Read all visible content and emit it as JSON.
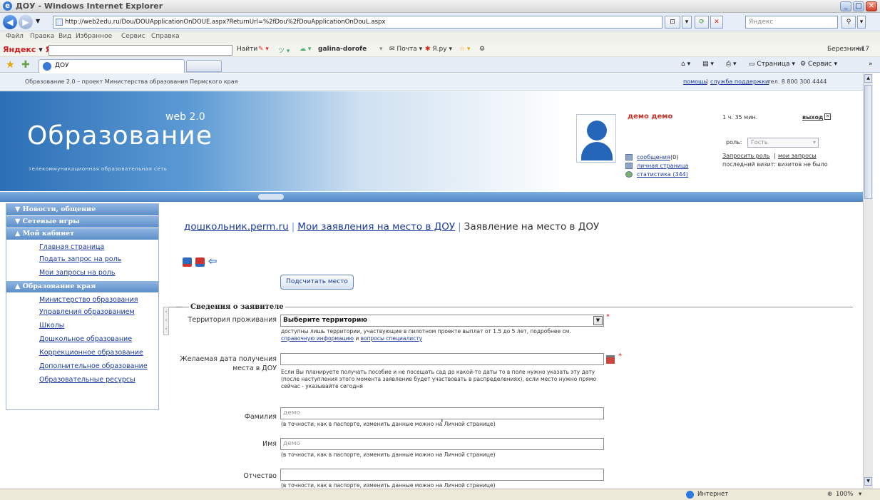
{
  "window": {
    "title": "ДОУ - Windows Internet Explorer",
    "url": "http://web2edu.ru/Dou/DOUApplicationOnDOUE.aspx?ReturnUrl=%2fDou%2fDouApplicationOnDouL.aspx",
    "search_placeholder": "Яндекс"
  },
  "menu": [
    "Файл",
    "Правка",
    "Вид",
    "Избранное",
    "Сервис",
    "Справка"
  ],
  "yandex_toolbar": {
    "logo_prefix": "Яндекс",
    "logo_ya": "Я",
    "find": "Найти",
    "user": "galina-dorofe",
    "mail": "Почта",
    "yaru": "Я.ру",
    "right_user": "Березники",
    "temp": "+17"
  },
  "tabs": {
    "active": "ДОУ",
    "commands": [
      "Страница",
      "Сервис"
    ]
  },
  "site": {
    "top_strip": "Образование 2.0 – проект Министерства образования Пермского края",
    "help": "помощь",
    "support": "служба поддержки",
    "phone": "тел. 8 800 300 4444",
    "logo": "Образование",
    "logo_web": "web 2.0",
    "logo_sub": "телекоммуникационная образовательная сеть"
  },
  "user": {
    "name": "демо демо",
    "links": [
      "сообщения",
      "личная страница",
      "статистика (344)"
    ],
    "messages_count": "(0)",
    "time": "1 ч. 35 мин.",
    "logout": "выход",
    "role_label": "роль:",
    "role_value": "Гость",
    "request_role": "Запросить роль",
    "my_requests": "мои запросы",
    "last_visit": "последний визит: визитов не было"
  },
  "sidebar": {
    "sections": [
      {
        "title": "Новости, общение",
        "expanded": false,
        "items": []
      },
      {
        "title": "Сетевые игры",
        "expanded": false,
        "items": []
      },
      {
        "title": "Мой кабинет",
        "expanded": true,
        "items": [
          "Главная страница",
          "Подать запрос на роль",
          "Мои запросы на роль"
        ]
      },
      {
        "title": "Образование края",
        "expanded": true,
        "items": [
          "Министерство образования",
          "Управления образованием",
          "Школы",
          "Дошкольное образование",
          "Коррекционное образование",
          "Дополнительное образование",
          "Образовательные ресурсы"
        ]
      }
    ]
  },
  "content": {
    "breadcrumb": [
      "дошкольник.perm.ru",
      "Мои заявления на место в ДОУ"
    ],
    "page_title": "Заявление на место в ДОУ",
    "count_button": "Подсчитать место",
    "section": "Сведения о заявителе",
    "fields": {
      "territory_label": "Территория проживания",
      "territory_value": "Выберите территорию",
      "territory_hint": "доступны лишь территории, участвующие в пилотном проекте выплат от 1.5 до 5 лет, подробнее см.",
      "territory_hint_link1": "справочную информацию",
      "territory_hint_and": "и",
      "territory_hint_link2": "вопросы специалисту",
      "date_label": "Желаемая дата получения места в ДОУ",
      "date_value": "",
      "date_hint": "Если Вы планируете получать пособие и не посещать сад до какой-то даты то в поле нужно указать эту дату (после наступления этого момента заявление будет участвовать в распределениях), если место нужно прямо сейчас - указывайте сегодня",
      "lastname_label": "Фамилия",
      "lastname_value": "демо",
      "firstname_label": "Имя",
      "firstname_value": "демо",
      "middlename_label": "Отчество",
      "middlename_value": "",
      "passport_hint": "(в точности, как в паспорте, изменить данные можно на Личной странице)"
    }
  },
  "status": {
    "zone": "Интернет",
    "zoom": "100%"
  },
  "colors": {
    "link": "#1a3a9e",
    "sidebar_head": "#5c8ec8",
    "username": "#c8322a",
    "required": "#dd1111"
  }
}
